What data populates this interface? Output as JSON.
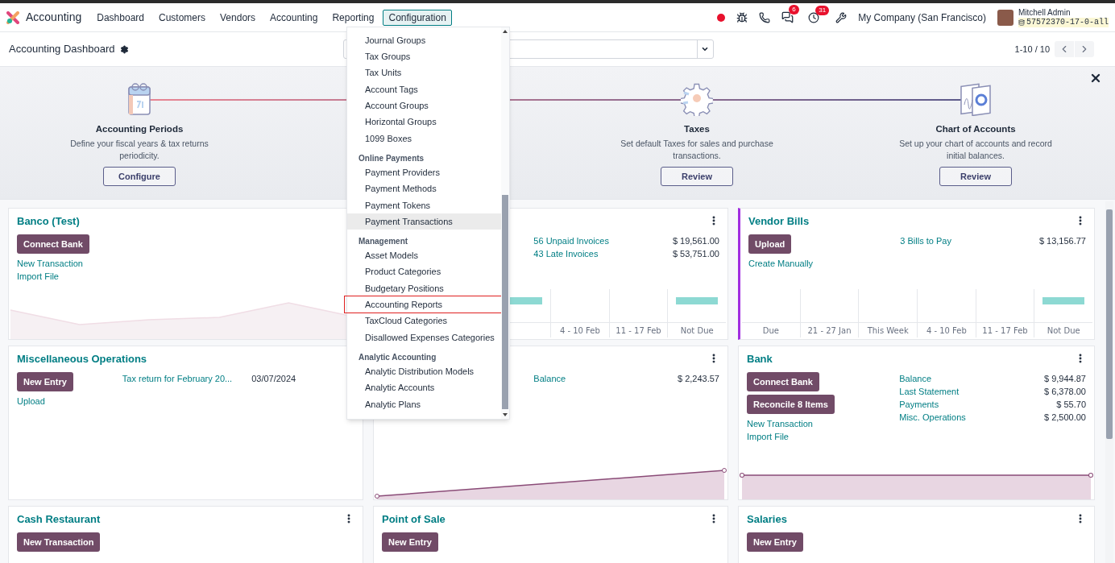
{
  "topbar": {
    "app_name": "Accounting",
    "menus": [
      {
        "label": "Dashboard",
        "selected": false
      },
      {
        "label": "Customers",
        "selected": false
      },
      {
        "label": "Vendors",
        "selected": false
      },
      {
        "label": "Accounting",
        "selected": false
      },
      {
        "label": "Reporting",
        "selected": false
      },
      {
        "label": "Configuration",
        "selected": true
      }
    ],
    "messages_count": "6",
    "activities_count": "31",
    "company": "My Company (San Francisco)",
    "user": "Mitchell Admin",
    "database": "57572370-17-0-all"
  },
  "control_panel": {
    "title": "Accounting Dashboard",
    "pager": "1-10 / 10"
  },
  "onboarding": {
    "steps": [
      {
        "kind": "calendar",
        "title": "Accounting Periods",
        "description": "Define your fiscal years & tax returns periodicity.",
        "button": "Configure"
      },
      {
        "kind": "hidden"
      },
      {
        "kind": "gear",
        "title": "Taxes",
        "description": "Set default Taxes for sales and purchase transactions.",
        "button": "Review"
      },
      {
        "kind": "chart",
        "title": "Chart of Accounts",
        "description": "Set up your chart of accounts and record initial balances.",
        "button": "Review"
      }
    ]
  },
  "cards": [
    {
      "title": "Banco (Test)",
      "accent_bar": false,
      "buttons": [
        "Connect Bank"
      ],
      "links": [
        "New Transaction",
        "Import File"
      ],
      "graph": {
        "kind": "line_faint"
      }
    },
    {
      "accent_bar": false,
      "stats": [
        {
          "kind": "total",
          "label": "56 Unpaid Invoices",
          "amount": "$ 19,561.00"
        },
        {
          "kind": "total",
          "label": "43 Late Invoices",
          "amount": "$ 53,751.00"
        }
      ],
      "graph": {
        "kind": "bars_two",
        "labels": [
          "4 - 10 Feb",
          "11 - 17 Feb",
          "Not Due"
        ]
      }
    },
    {
      "title": "Vendor Bills",
      "accent_bar": true,
      "buttons": [
        "Upload"
      ],
      "links": [
        "Create Manually"
      ],
      "stats": [
        {
          "kind": "total",
          "label": "3 Bills to Pay",
          "amount": "$ 13,156.77"
        }
      ],
      "graph": {
        "kind": "bars",
        "labels": [
          "Due",
          "21 - 27 Jan",
          "This Week",
          "4 - 10 Feb",
          "11 - 17 Feb",
          "Not Due"
        ]
      }
    },
    {
      "title": "Miscellaneous Operations",
      "accent_bar": false,
      "buttons": [
        "New Entry"
      ],
      "links": [
        "Upload"
      ],
      "stats": [
        {
          "kind": "entry",
          "label": "Tax return for February 20...",
          "amount": "03/07/2024"
        }
      ]
    },
    {
      "accent_bar": false,
      "stats": [
        {
          "kind": "total",
          "label": "Balance",
          "amount": "$ 2,243.57"
        }
      ],
      "graph": {
        "kind": "line_rising"
      }
    },
    {
      "title": "Bank",
      "accent_bar": false,
      "buttons": [
        "Connect Bank",
        "Reconcile 8 Items"
      ],
      "links": [
        "New Transaction",
        "Import File"
      ],
      "stats": [
        {
          "kind": "total",
          "label": "Balance",
          "amount": "$ 9,944.87"
        },
        {
          "kind": "total",
          "label": "Last Statement",
          "amount": "$ 6,378.00"
        },
        {
          "kind": "total",
          "label": "Payments",
          "amount": "$ 55.70"
        },
        {
          "kind": "total",
          "label": "Misc. Operations",
          "amount": "$ 2,500.00"
        }
      ],
      "graph": {
        "kind": "line_flat"
      }
    },
    {
      "title": "Cash Restaurant",
      "accent_bar": false,
      "buttons": [
        "New Transaction"
      ]
    },
    {
      "title": "Point of Sale",
      "accent_bar": false,
      "buttons": [
        "New Entry"
      ]
    },
    {
      "title": "Salaries",
      "accent_bar": false,
      "buttons": [
        "New Entry"
      ]
    }
  ],
  "dropdown": {
    "sections": [
      {
        "items": [
          {
            "label": "Journal Groups",
            "hovered": false,
            "highlighted": false
          },
          {
            "label": "Tax Groups",
            "hovered": false,
            "highlighted": false
          },
          {
            "label": "Tax Units",
            "hovered": false,
            "highlighted": false
          },
          {
            "label": "Account Tags",
            "hovered": false,
            "highlighted": false
          },
          {
            "label": "Account Groups",
            "hovered": false,
            "highlighted": false
          },
          {
            "label": "Horizontal Groups",
            "hovered": false,
            "highlighted": false
          },
          {
            "label": "1099 Boxes",
            "hovered": false,
            "highlighted": false
          }
        ]
      },
      {
        "heading": "Online Payments",
        "items": [
          {
            "label": "Payment Providers",
            "hovered": false,
            "highlighted": false
          },
          {
            "label": "Payment Methods",
            "hovered": false,
            "highlighted": false
          },
          {
            "label": "Payment Tokens",
            "hovered": false,
            "highlighted": false
          },
          {
            "label": "Payment Transactions",
            "hovered": true,
            "highlighted": false
          }
        ]
      },
      {
        "heading": "Management",
        "items": [
          {
            "label": "Asset Models",
            "hovered": false,
            "highlighted": false
          },
          {
            "label": "Product Categories",
            "hovered": false,
            "highlighted": false
          },
          {
            "label": "Budgetary Positions",
            "hovered": false,
            "highlighted": false
          },
          {
            "label": "Accounting Reports",
            "hovered": false,
            "highlighted": true
          },
          {
            "label": "TaxCloud Categories",
            "hovered": false,
            "highlighted": false
          },
          {
            "label": "Disallowed Expenses Categories",
            "hovered": false,
            "highlighted": false
          }
        ]
      },
      {
        "heading": "Analytic Accounting",
        "items": [
          {
            "label": "Analytic Distribution Models",
            "hovered": false,
            "highlighted": false
          },
          {
            "label": "Analytic Accounts",
            "hovered": false,
            "highlighted": false
          },
          {
            "label": "Analytic Plans",
            "hovered": false,
            "highlighted": false
          }
        ]
      }
    ]
  }
}
